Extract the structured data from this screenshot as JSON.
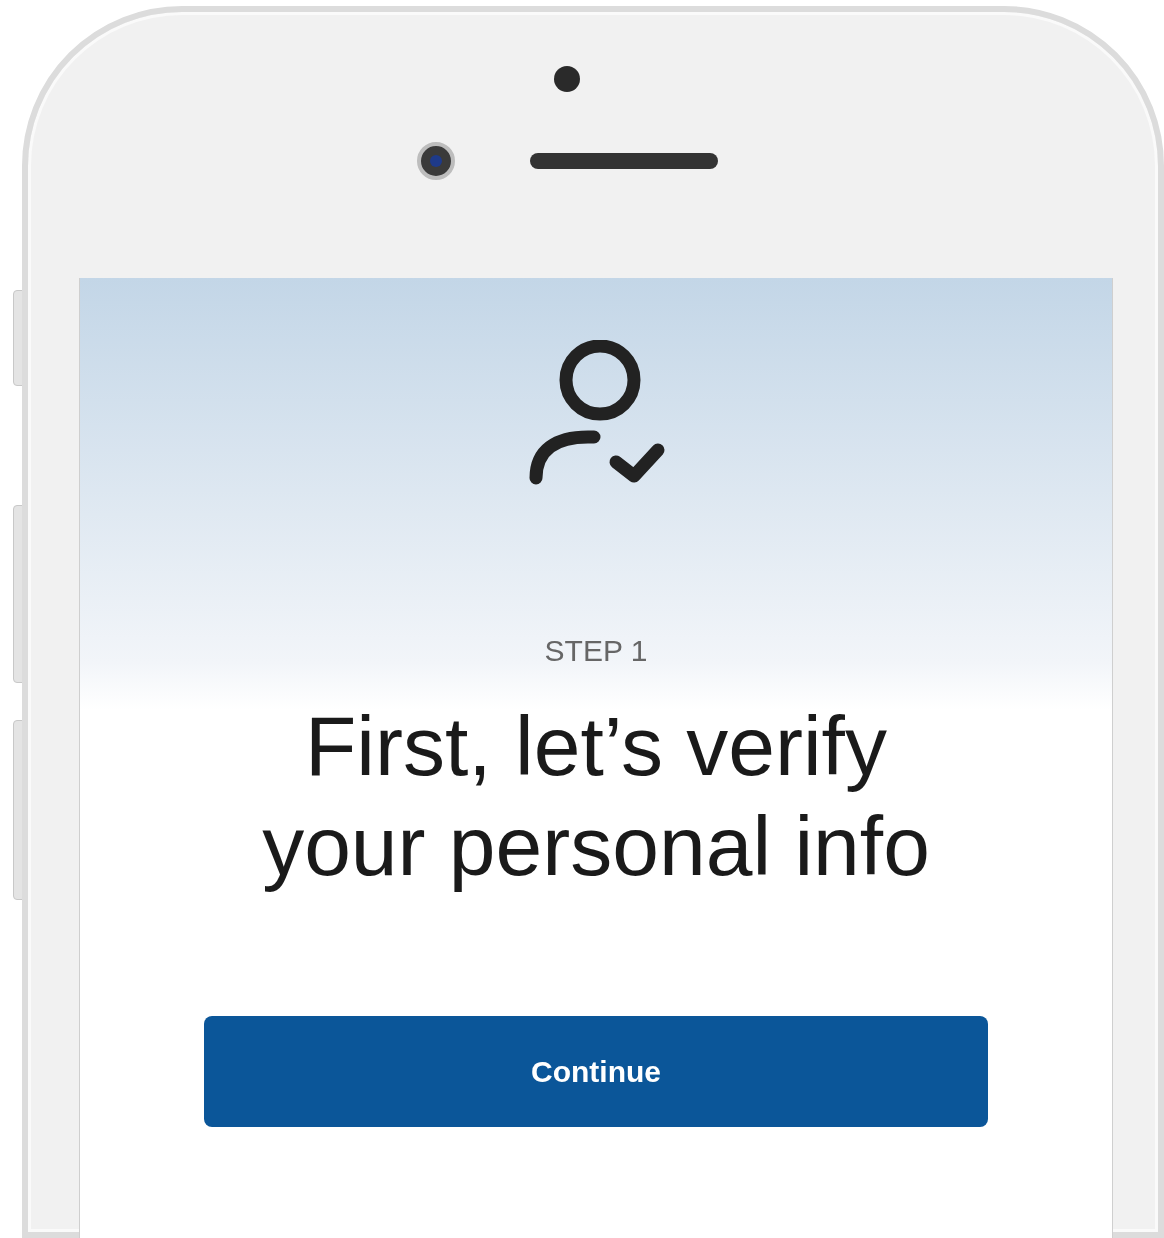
{
  "step_label": "STEP 1",
  "heading": "First, let’s verify your personal info",
  "button": {
    "label": "Continue"
  }
}
